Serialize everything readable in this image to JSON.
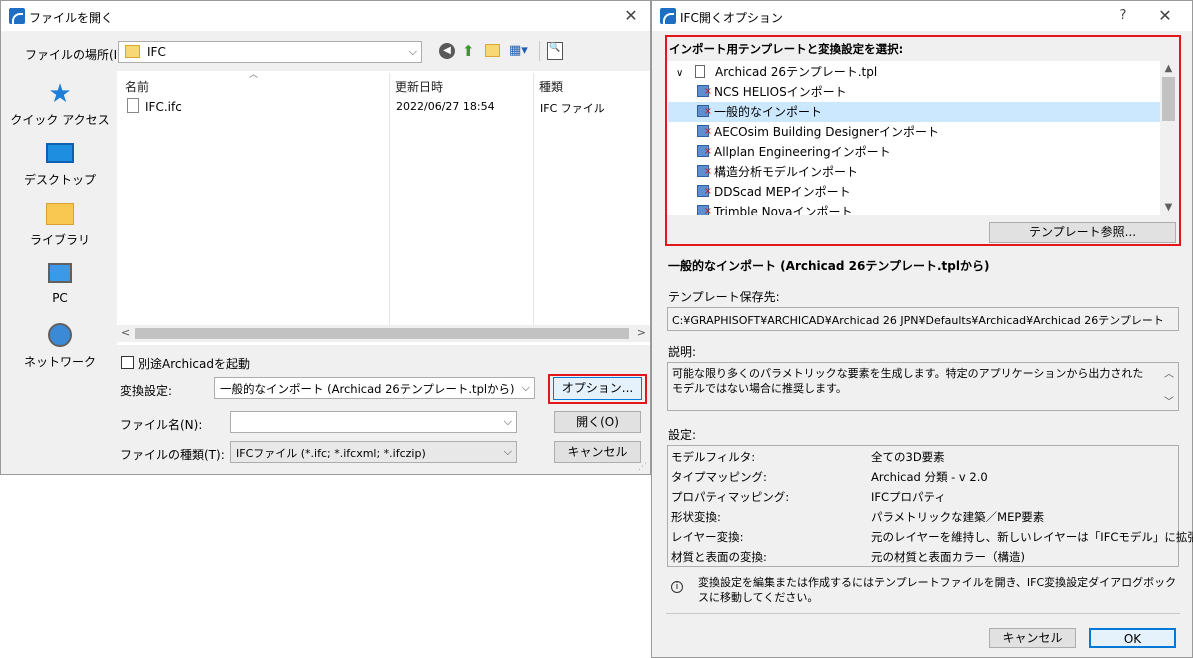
{
  "open_dialog": {
    "title": "ファイルを開く",
    "location_label": "ファイルの場所(I):",
    "location_value": "IFC",
    "sidebar": [
      {
        "label": "クイック アクセス",
        "icon": "star-icon"
      },
      {
        "label": "デスクトップ",
        "icon": "desktop-icon"
      },
      {
        "label": "ライブラリ",
        "icon": "library-folder-icon"
      },
      {
        "label": "PC",
        "icon": "pc-icon"
      },
      {
        "label": "ネットワーク",
        "icon": "network-icon"
      }
    ],
    "columns": {
      "name": "名前",
      "date": "更新日時",
      "type": "種類"
    },
    "files": [
      {
        "name": "IFC.ifc",
        "date": "2022/06/27 18:54",
        "type": "IFC ファイル"
      }
    ],
    "separate_archicad_label": "別途Archicadを起動",
    "conversion_label": "変換設定:",
    "conversion_value": "一般的なインポート (Archicad 26テンプレート.tplから)",
    "options_button": "オプション...",
    "filename_label": "ファイル名(N):",
    "filename_value": "",
    "open_button": "開く(O)",
    "filetype_label": "ファイルの種類(T):",
    "filetype_value": "IFCファイル (*.ifc; *.ifcxml; *.ifczip)",
    "cancel_button": "キャンセル"
  },
  "ifc_dialog": {
    "title": "IFC開くオプション",
    "help": "?",
    "template_section_title": "インポート用テンプレートと変換設定を選択:",
    "tree_root": "Archicad 26テンプレート.tpl",
    "tree_items": [
      {
        "label": "NCS HELIOSインポート",
        "selected": false
      },
      {
        "label": "一般的なインポート",
        "selected": true
      },
      {
        "label": "AECOsim Building Designerインポート",
        "selected": false
      },
      {
        "label": "Allplan Engineeringインポート",
        "selected": false
      },
      {
        "label": "構造分析モデルインポート",
        "selected": false
      },
      {
        "label": "DDScad MEPインポート",
        "selected": false
      },
      {
        "label": "Trimble Novaインポート",
        "selected": false
      }
    ],
    "browse_button": "テンプレート参照...",
    "selected_title": "一般的なインポート (Archicad 26テンプレート.tplから)",
    "storage_label": "テンプレート保存先:",
    "storage_path": "C:¥GRAPHISOFT¥ARCHICAD¥Archicad 26 JPN¥Defaults¥Archicad¥Archicad 26テンプレート",
    "description_label": "説明:",
    "description_text": "可能な限り多くのパラメトリックな要素を生成します。特定のアプリケーションから出力されたモデルではない場合に推奨します。",
    "settings_label": "設定:",
    "settings": [
      {
        "key": "モデルフィルタ:",
        "value": "全ての3D要素"
      },
      {
        "key": "タイプマッピング:",
        "value": "Archicad 分類 - v 2.0"
      },
      {
        "key": "プロパティマッピング:",
        "value": "IFCプロパティ"
      },
      {
        "key": "形状変換:",
        "value": "パラメトリックな建築／MEP要素"
      },
      {
        "key": "レイヤー変換:",
        "value": "元のレイヤーを維持し、新しいレイヤーは「IFCモデル」に拡張"
      },
      {
        "key": "材質と表面の変換:",
        "value": "元の材質と表面カラー（構造)"
      }
    ],
    "info_text": "変換設定を編集または作成するにはテンプレートファイルを開き、IFC変換設定ダイアログボックスに移動してください。",
    "cancel_button": "キャンセル",
    "ok_button": "OK"
  },
  "colors": {
    "highlight_red": "#e5161b",
    "selection": "#cce8ff",
    "default_button": "#0078d7"
  }
}
